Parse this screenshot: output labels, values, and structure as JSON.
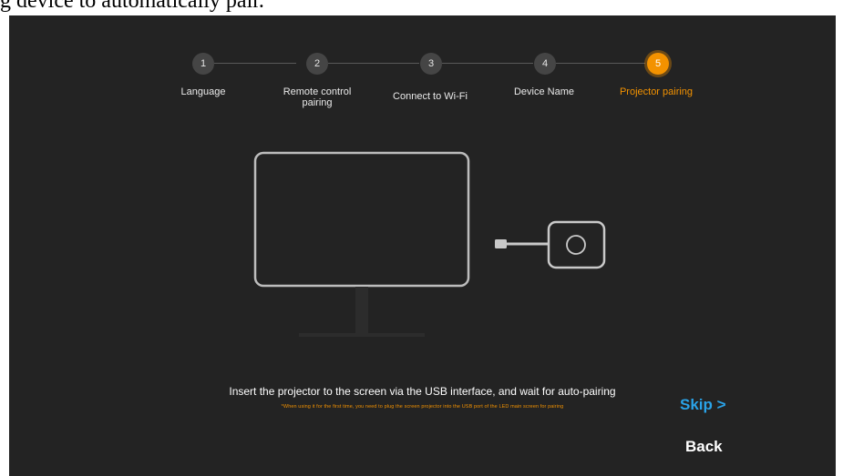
{
  "caption": "g device to automatically pair.",
  "steps": [
    {
      "num": "1",
      "label": "Language"
    },
    {
      "num": "2",
      "label": "Remote control pairing"
    },
    {
      "num": "3",
      "label": "Connect to Wi-Fi"
    },
    {
      "num": "4",
      "label": "Device Name"
    },
    {
      "num": "5",
      "label": "Projector pairing"
    }
  ],
  "active_step": 5,
  "instructions": {
    "main": "Insert the projector to the screen via the USB interface, and wait for auto-pairing",
    "note": "*When using it for the first time, you need to plug the screen projector into the USB port of the LED main screen for pairing"
  },
  "actions": {
    "skip_label": "Skip >",
    "back_label": "Back"
  },
  "colors": {
    "background": "#232323",
    "accent": "#f39200",
    "skip": "#2aa3e8"
  }
}
